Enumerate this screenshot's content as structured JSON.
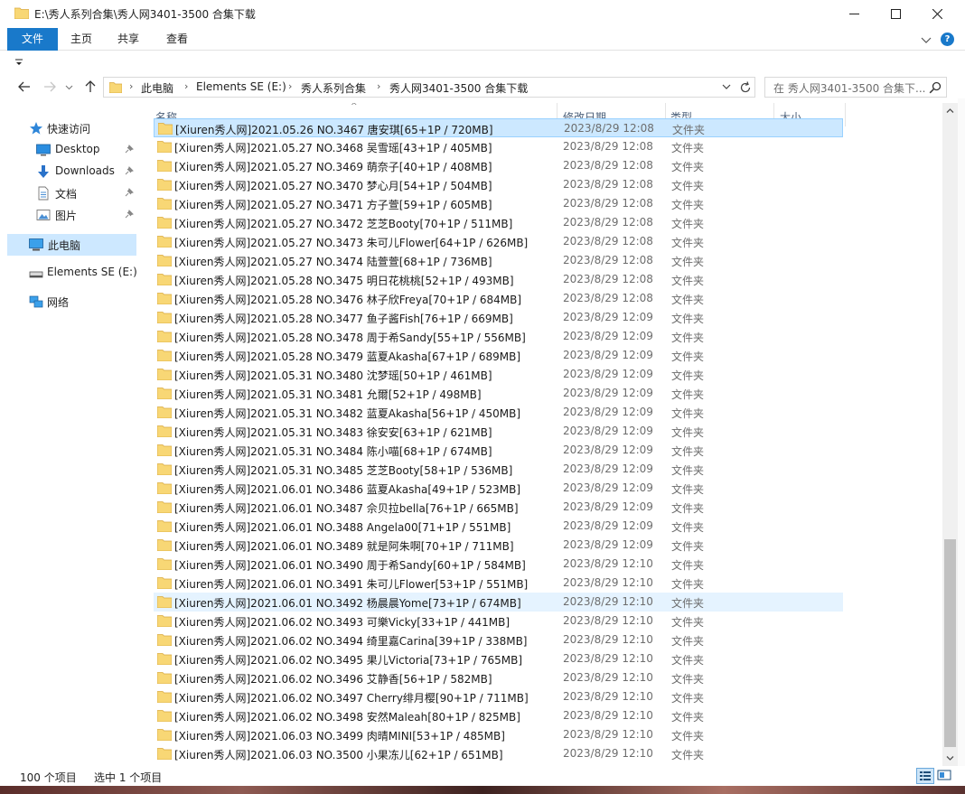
{
  "window": {
    "title": "E:\\秀人系列合集\\秀人网3401-3500 合集下载"
  },
  "ribbon": {
    "tabs": [
      "文件",
      "主页",
      "共享",
      "查看"
    ]
  },
  "address": {
    "crumbs": [
      "此电脑",
      "Elements SE (E:)",
      "秀人系列合集",
      "秀人网3401-3500 合集下载"
    ]
  },
  "search": {
    "placeholder": "在 秀人网3401-3500 合集下..."
  },
  "nav": {
    "items": [
      {
        "label": "快速访问",
        "icon": "star-icon"
      },
      {
        "label": "Desktop",
        "icon": "desktop-icon",
        "pinned": true
      },
      {
        "label": "Downloads",
        "icon": "download-icon",
        "pinned": true
      },
      {
        "label": "文档",
        "icon": "documents-icon",
        "pinned": true
      },
      {
        "label": "图片",
        "icon": "pictures-icon",
        "pinned": true
      },
      {
        "label": "此电脑",
        "icon": "computer-icon",
        "selected": true
      },
      {
        "label": "Elements SE (E:)",
        "icon": "drive-icon"
      },
      {
        "label": "网络",
        "icon": "network-icon"
      }
    ]
  },
  "columns": {
    "name": "名称",
    "date": "修改日期",
    "type": "类型",
    "size": "大小"
  },
  "files": [
    {
      "name": "[Xiuren秀人网]2021.05.26 NO.3467 唐安琪[65+1P / 720MB]",
      "date": "2023/8/29 12:08",
      "type": "文件夹"
    },
    {
      "name": "[Xiuren秀人网]2021.05.27 NO.3468 吴雪瑶[43+1P / 405MB]",
      "date": "2023/8/29 12:08",
      "type": "文件夹"
    },
    {
      "name": "[Xiuren秀人网]2021.05.27 NO.3469 萌奈子[40+1P / 408MB]",
      "date": "2023/8/29 12:08",
      "type": "文件夹"
    },
    {
      "name": "[Xiuren秀人网]2021.05.27 NO.3470 梦心月[54+1P / 504MB]",
      "date": "2023/8/29 12:08",
      "type": "文件夹"
    },
    {
      "name": "[Xiuren秀人网]2021.05.27 NO.3471 方子萱[59+1P / 605MB]",
      "date": "2023/8/29 12:08",
      "type": "文件夹"
    },
    {
      "name": "[Xiuren秀人网]2021.05.27 NO.3472 芝芝Booty[70+1P / 511MB]",
      "date": "2023/8/29 12:08",
      "type": "文件夹"
    },
    {
      "name": "[Xiuren秀人网]2021.05.27 NO.3473 朱可儿Flower[64+1P / 626MB]",
      "date": "2023/8/29 12:08",
      "type": "文件夹"
    },
    {
      "name": "[Xiuren秀人网]2021.05.27 NO.3474 陆萱萱[68+1P / 736MB]",
      "date": "2023/8/29 12:08",
      "type": "文件夹"
    },
    {
      "name": "[Xiuren秀人网]2021.05.28 NO.3475 明日花桃桃[52+1P / 493MB]",
      "date": "2023/8/29 12:08",
      "type": "文件夹"
    },
    {
      "name": "[Xiuren秀人网]2021.05.28 NO.3476 林子欣Freya[70+1P / 684MB]",
      "date": "2023/8/29 12:08",
      "type": "文件夹"
    },
    {
      "name": "[Xiuren秀人网]2021.05.28 NO.3477 鱼子酱Fish[76+1P / 669MB]",
      "date": "2023/8/29 12:09",
      "type": "文件夹"
    },
    {
      "name": "[Xiuren秀人网]2021.05.28 NO.3478 周于希Sandy[55+1P / 556MB]",
      "date": "2023/8/29 12:09",
      "type": "文件夹"
    },
    {
      "name": "[Xiuren秀人网]2021.05.28 NO.3479 蓝夏Akasha[67+1P / 689MB]",
      "date": "2023/8/29 12:09",
      "type": "文件夹"
    },
    {
      "name": "[Xiuren秀人网]2021.05.31 NO.3480 沈梦瑶[50+1P / 461MB]",
      "date": "2023/8/29 12:09",
      "type": "文件夹"
    },
    {
      "name": "[Xiuren秀人网]2021.05.31 NO.3481 允爾[52+1P / 498MB]",
      "date": "2023/8/29 12:09",
      "type": "文件夹"
    },
    {
      "name": "[Xiuren秀人网]2021.05.31 NO.3482 蓝夏Akasha[56+1P / 450MB]",
      "date": "2023/8/29 12:09",
      "type": "文件夹"
    },
    {
      "name": "[Xiuren秀人网]2021.05.31 NO.3483 徐安安[63+1P / 621MB]",
      "date": "2023/8/29 12:09",
      "type": "文件夹"
    },
    {
      "name": "[Xiuren秀人网]2021.05.31 NO.3484 陈小喵[68+1P / 674MB]",
      "date": "2023/8/29 12:09",
      "type": "文件夹"
    },
    {
      "name": "[Xiuren秀人网]2021.05.31 NO.3485 芝芝Booty[58+1P / 536MB]",
      "date": "2023/8/29 12:09",
      "type": "文件夹"
    },
    {
      "name": "[Xiuren秀人网]2021.06.01 NO.3486 蓝夏Akasha[49+1P / 523MB]",
      "date": "2023/8/29 12:09",
      "type": "文件夹"
    },
    {
      "name": "[Xiuren秀人网]2021.06.01 NO.3487 佘贝拉bella[76+1P / 665MB]",
      "date": "2023/8/29 12:09",
      "type": "文件夹"
    },
    {
      "name": "[Xiuren秀人网]2021.06.01 NO.3488 Angela00[71+1P / 551MB]",
      "date": "2023/8/29 12:09",
      "type": "文件夹"
    },
    {
      "name": "[Xiuren秀人网]2021.06.01 NO.3489 就是阿朱啊[70+1P / 711MB]",
      "date": "2023/8/29 12:09",
      "type": "文件夹"
    },
    {
      "name": "[Xiuren秀人网]2021.06.01 NO.3490 周于希Sandy[60+1P / 584MB]",
      "date": "2023/8/29 12:10",
      "type": "文件夹"
    },
    {
      "name": "[Xiuren秀人网]2021.06.01 NO.3491 朱可儿Flower[53+1P / 551MB]",
      "date": "2023/8/29 12:10",
      "type": "文件夹"
    },
    {
      "name": "[Xiuren秀人网]2021.06.01 NO.3492 杨晨晨Yome[73+1P / 674MB]",
      "date": "2023/8/29 12:10",
      "type": "文件夹",
      "hover": true
    },
    {
      "name": "[Xiuren秀人网]2021.06.02 NO.3493 可樂Vicky[33+1P / 441MB]",
      "date": "2023/8/29 12:10",
      "type": "文件夹"
    },
    {
      "name": "[Xiuren秀人网]2021.06.02 NO.3494 绮里嘉Carina[39+1P / 338MB]",
      "date": "2023/8/29 12:10",
      "type": "文件夹"
    },
    {
      "name": "[Xiuren秀人网]2021.06.02 NO.3495 果儿Victoria[73+1P / 765MB]",
      "date": "2023/8/29 12:10",
      "type": "文件夹"
    },
    {
      "name": "[Xiuren秀人网]2021.06.02 NO.3496 艾静香[56+1P / 582MB]",
      "date": "2023/8/29 12:10",
      "type": "文件夹"
    },
    {
      "name": "[Xiuren秀人网]2021.06.02 NO.3497 Cherry绯月樱[90+1P / 711MB]",
      "date": "2023/8/29 12:10",
      "type": "文件夹"
    },
    {
      "name": "[Xiuren秀人网]2021.06.02 NO.3498 安然Maleah[80+1P / 825MB]",
      "date": "2023/8/29 12:10",
      "type": "文件夹"
    },
    {
      "name": "[Xiuren秀人网]2021.06.03 NO.3499 肉晴MINI[53+1P / 485MB]",
      "date": "2023/8/29 12:10",
      "type": "文件夹"
    },
    {
      "name": "[Xiuren秀人网]2021.06.03 NO.3500 小果冻儿[62+1P / 651MB]",
      "date": "2023/8/29 12:10",
      "type": "文件夹"
    }
  ],
  "status": {
    "count": "100 个项目",
    "selected": "选中 1 个项目"
  },
  "colors": {
    "accent": "#1979ca",
    "selection": "#cce8ff",
    "hover": "#e5f3ff",
    "folder": "#f8d775"
  }
}
